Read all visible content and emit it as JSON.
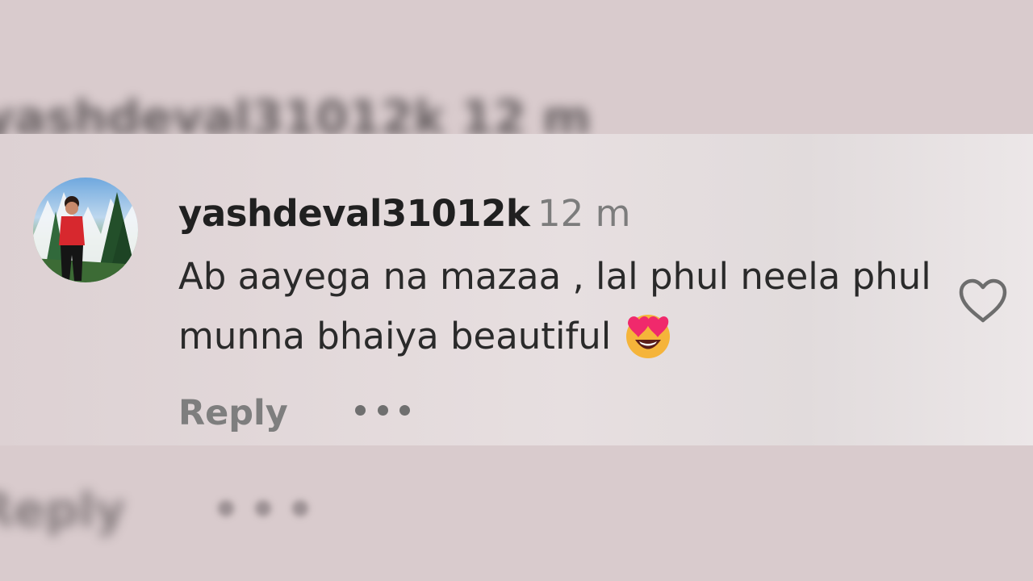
{
  "background": {
    "top_blurred_username": "yashdeval31012k 12 m",
    "bottom_blurred_reply": "Reply"
  },
  "comment": {
    "username": "yashdeval31012k",
    "timestamp": "12 m",
    "text": "Ab aayega na mazaa , lal phul neela phul munna bhaiya beautiful",
    "emoji": "star-struck-face",
    "reply_label": "Reply",
    "more_icon": "more-horizontal-icon",
    "like_icon": "heart-outline-icon"
  },
  "colors": {
    "card_background": "#e5dcdd",
    "page_background": "#d9cbcd",
    "username": "#202020",
    "timestamp": "#7c7c7c",
    "reply": "#7e7e7e"
  }
}
